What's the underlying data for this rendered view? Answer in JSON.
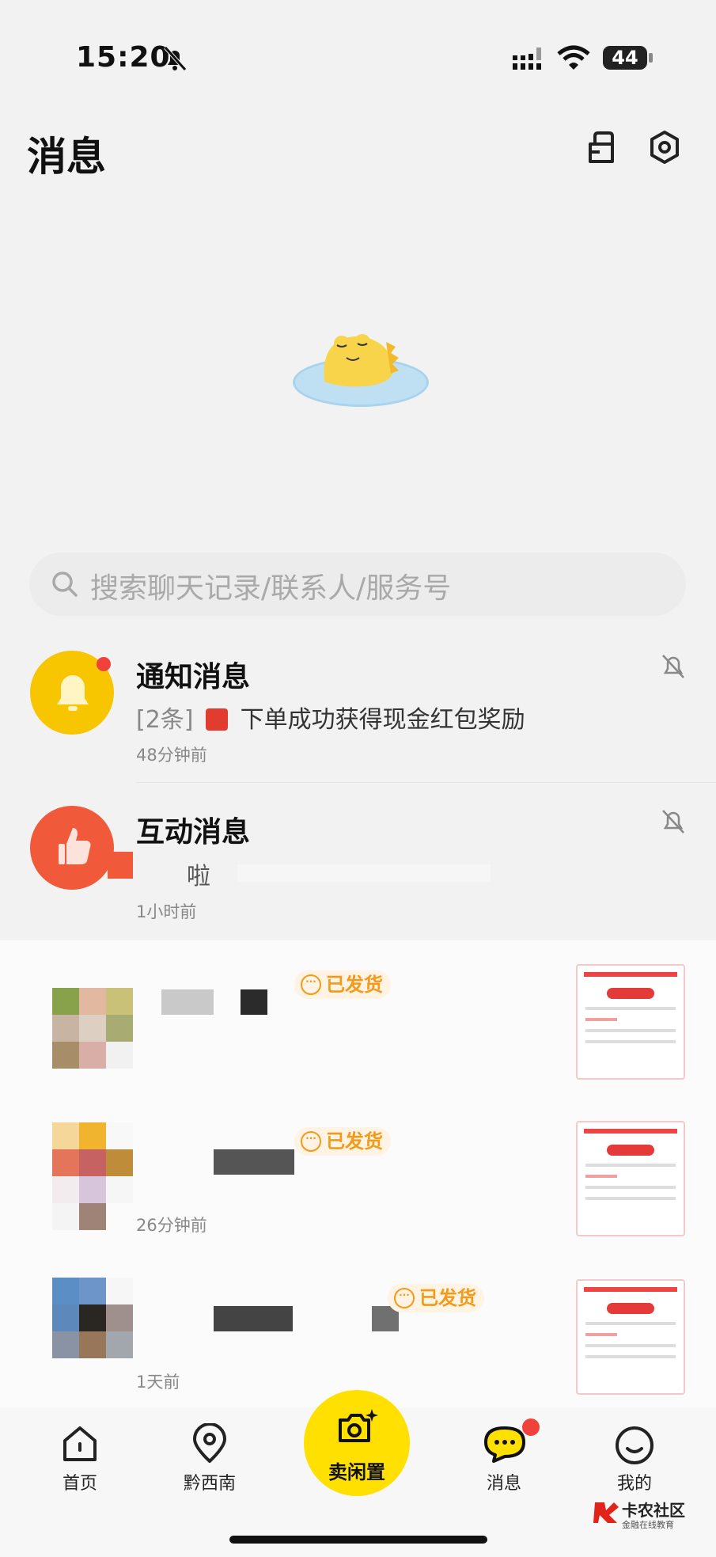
{
  "status_bar": {
    "time": "15:20",
    "battery": "44"
  },
  "header": {
    "title": "消息"
  },
  "search": {
    "placeholder": "搜索聊天记录/联系人/服务号"
  },
  "rows": [
    {
      "title": "通知消息",
      "subtitle_prefix": "[2条]",
      "subtitle_text": "下单成功获得现金红包奖励",
      "time": "48分钟前"
    },
    {
      "title": "互动消息",
      "subtitle_text": "啦",
      "time": "1小时前"
    }
  ],
  "chats": [
    {
      "status": "已发货",
      "time": ""
    },
    {
      "status": "已发货",
      "time": "26分钟前"
    },
    {
      "status": "已发货",
      "time": "1天前"
    }
  ],
  "tabbar": {
    "home": "首页",
    "local": "黔西南",
    "sell": "卖闲置",
    "messages": "消息",
    "mine": "我的"
  },
  "watermark": {
    "title": "卡农社区",
    "subtitle": "金融在线教育"
  },
  "colors": {
    "accent": "#ffe000",
    "notify": "#f7c600",
    "interact": "#f05a3a",
    "badge": "#f39a1b",
    "dot": "#f0413a"
  }
}
